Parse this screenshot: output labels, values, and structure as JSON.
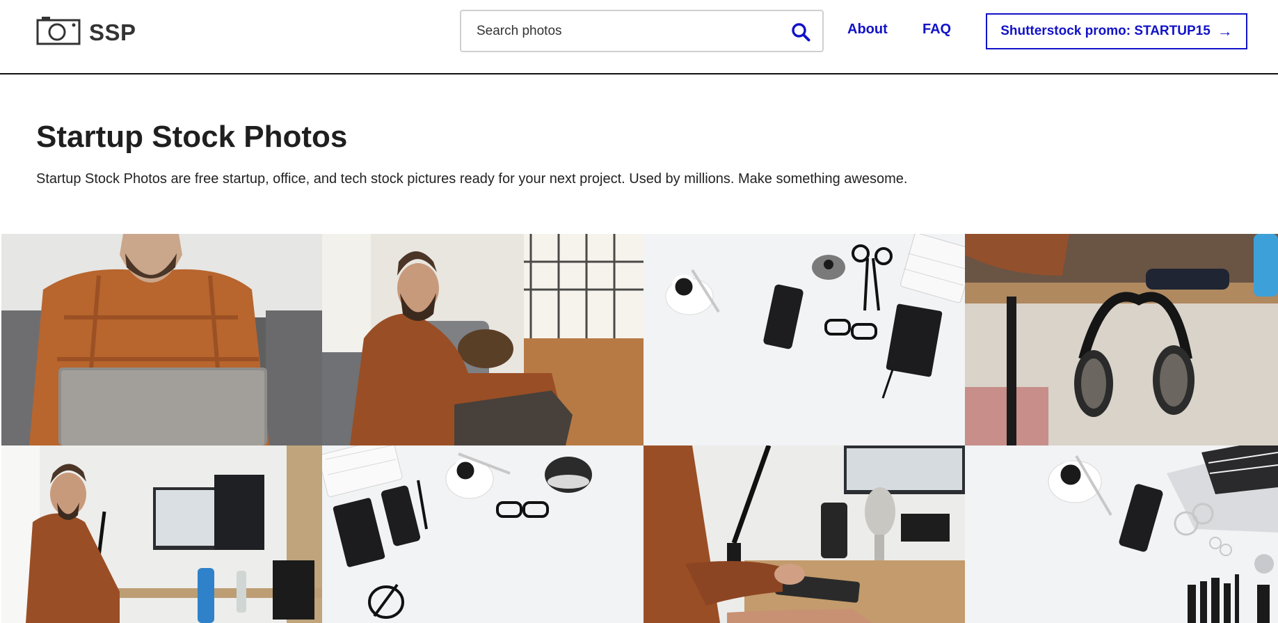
{
  "header": {
    "logo_text": "SSP",
    "search_placeholder": "Search photos",
    "nav": {
      "about": "About",
      "faq": "FAQ"
    },
    "promo_label": "Shutterstock promo: STARTUP15",
    "promo_arrow": "→"
  },
  "hero": {
    "title": "Startup Stock Photos",
    "subtitle": "Startup Stock Photos are free startup, office, and tech stock pictures ready for your next project. Used by millions. Make something awesome."
  },
  "colors": {
    "link": "#1212c8",
    "text": "#222222",
    "header_border": "#111111"
  },
  "photos": [
    {
      "subject": "man-laptop-couch"
    },
    {
      "subject": "man-dog-couch"
    },
    {
      "subject": "desk-flatlay-coffee-phone"
    },
    {
      "subject": "headphones-desk"
    },
    {
      "subject": "man-standing-desk-monitors"
    },
    {
      "subject": "flatlay-notebook-glasses"
    },
    {
      "subject": "man-typing-microphone"
    },
    {
      "subject": "flatlay-coffee-laptop"
    }
  ]
}
